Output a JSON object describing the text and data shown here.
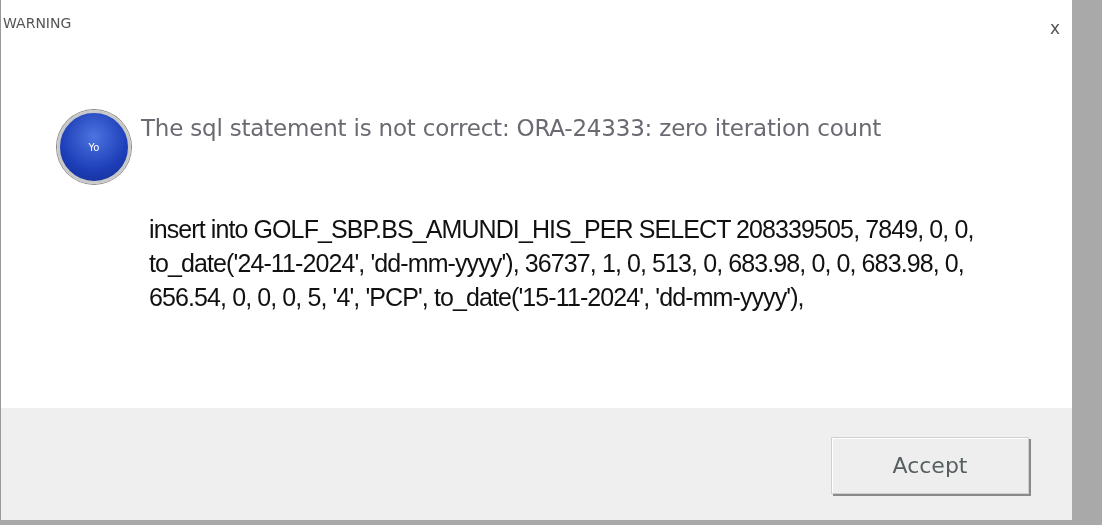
{
  "window": {
    "title": "WARNING",
    "close": "x"
  },
  "icon": {
    "label": "Yo"
  },
  "message": "The sql statement is not correct: ORA-24333: zero iteration count",
  "detail": "insert into GOLF_SBP.BS_AMUNDI_HIS_PER SELECT 208339505, 7849, 0, 0, to_date('24-11-2024', 'dd-mm-yyyy'), 36737, 1, 0, 513, 0, 683.98, 0, 0, 683.98, 0, 656.54, 0, 0, 0, 5, '4', 'PCP', to_date('15-11-2024', 'dd-mm-yyyy'),",
  "buttons": [
    "Accept"
  ]
}
